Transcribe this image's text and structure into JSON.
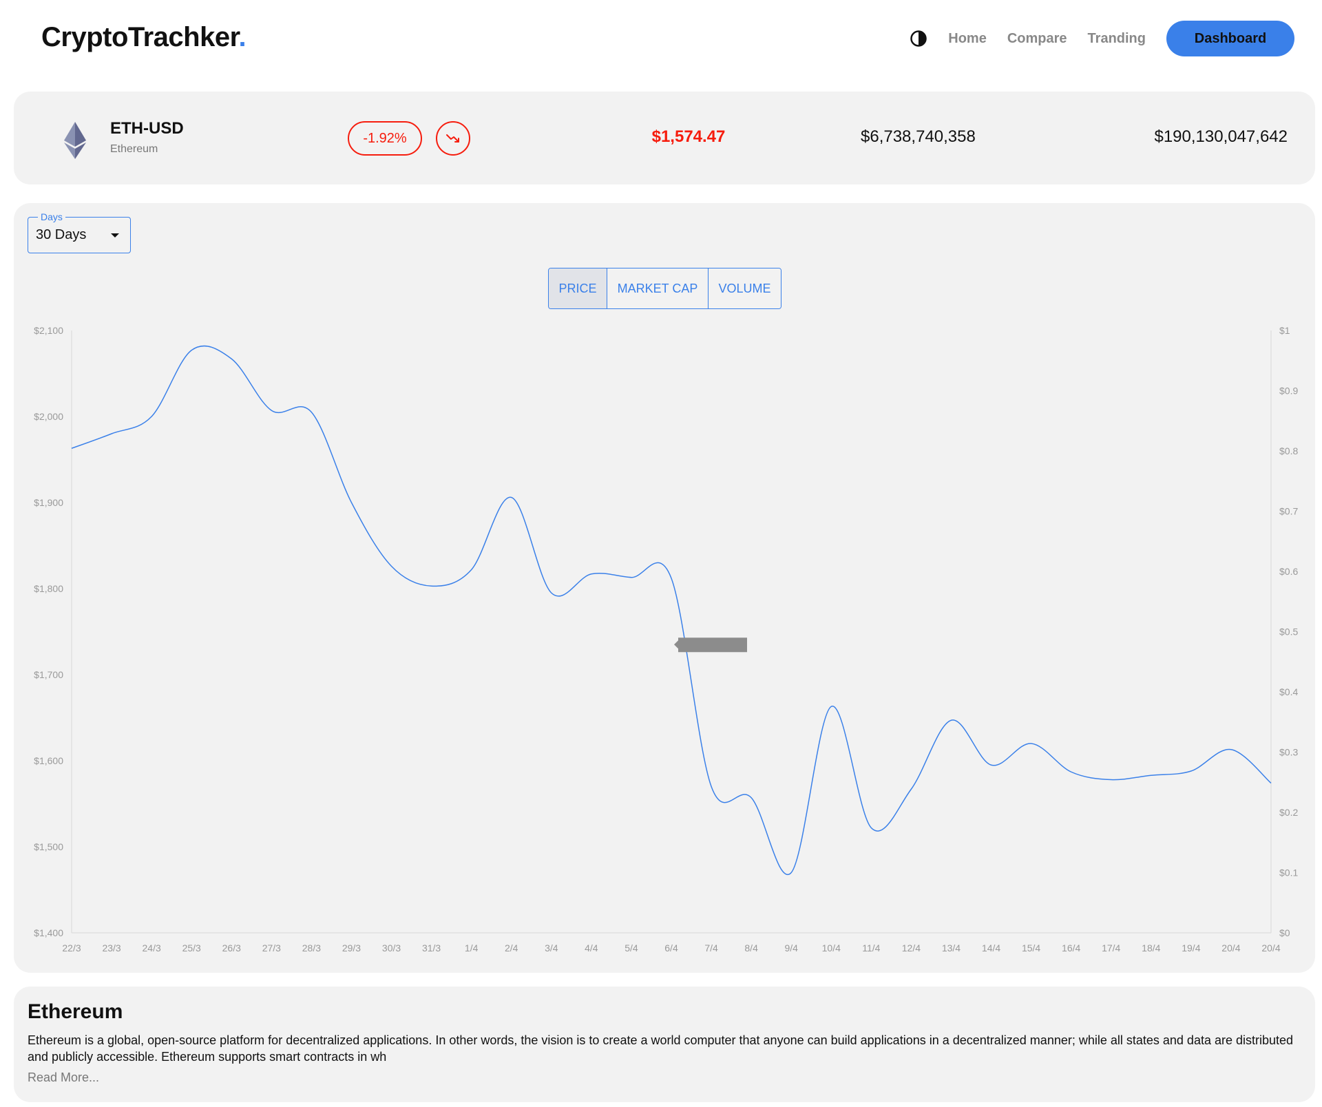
{
  "header": {
    "logo_text": "CryptoTrachker",
    "logo_dot": ".",
    "theme_icon": "half-circle-contrast-icon",
    "nav": [
      "Home",
      "Compare",
      "Tranding"
    ],
    "dashboard_label": "Dashboard",
    "accent_color": "#3a80e9"
  },
  "coin": {
    "icon": "ethereum-diamond-icon",
    "ticker": "ETH-USD",
    "name": "Ethereum",
    "change_pct": "-1.92%",
    "trend_icon": "trending-down-icon",
    "price": "$1,574.47",
    "volume": "$6,738,740,358",
    "market_cap": "$190,130,047,642",
    "negative_color": "#f61c0d"
  },
  "controls": {
    "days_label": "Days",
    "days_value": "30 Days",
    "toggles": [
      "PRICE",
      "MARKET CAP",
      "VOLUME"
    ],
    "active_toggle": "PRICE"
  },
  "chart_data": {
    "type": "line",
    "x": [
      "22/3",
      "23/3",
      "24/3",
      "25/3",
      "26/3",
      "27/3",
      "28/3",
      "29/3",
      "30/3",
      "31/3",
      "1/4",
      "2/4",
      "3/4",
      "4/4",
      "5/4",
      "6/4",
      "7/4",
      "8/4",
      "9/4",
      "10/4",
      "11/4",
      "12/4",
      "13/4",
      "14/4",
      "15/4",
      "16/4",
      "17/4",
      "18/4",
      "19/4",
      "20/4",
      "20/4"
    ],
    "series": [
      {
        "color": "#3a80e9",
        "values": [
          1963,
          1980,
          2000,
          2077,
          2067,
          2007,
          2005,
          1900,
          1826,
          1803,
          1822,
          1906,
          1795,
          1817,
          1813,
          1812,
          1570,
          1557,
          1470,
          1663,
          1522,
          1567,
          1647,
          1595,
          1620,
          1587,
          1578,
          1583,
          1588,
          1613,
          1574
        ]
      }
    ],
    "y_left": {
      "ticks": [
        "$2,100",
        "$2,000",
        "$1,900",
        "$1,800",
        "$1,700",
        "$1,600",
        "$1,500",
        "$1,400"
      ],
      "min": 1400,
      "max": 2100
    },
    "y_right": {
      "ticks": [
        "$1",
        "$0.9",
        "$0.8",
        "$0.7",
        "$0.6",
        "$0.5",
        "$0.4",
        "$0.3",
        "$0.2",
        "$0.1",
        "$0"
      ],
      "min": 0,
      "max": 1
    },
    "grid": false,
    "legend": "none"
  },
  "about": {
    "title": "Ethereum",
    "description": "Ethereum is a global, open-source platform for decentralized applications. In other words, the vision is to create a world computer that anyone can build applications in a decentralized manner; while all states and data are distributed and publicly accessible. Ethereum supports smart contracts in wh",
    "read_more": "Read More..."
  }
}
